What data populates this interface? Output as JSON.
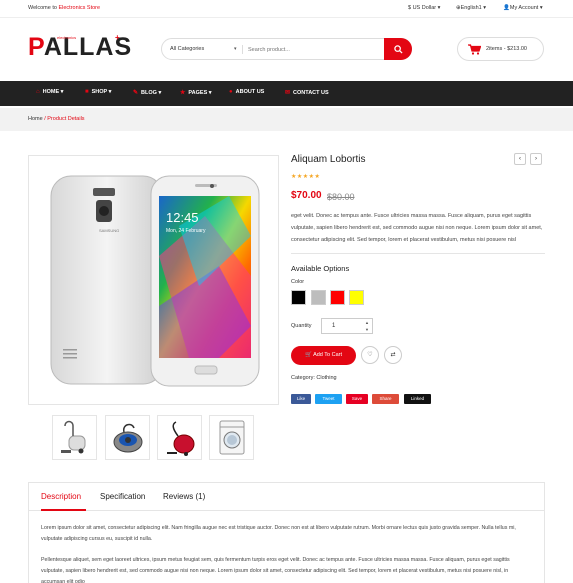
{
  "topbar": {
    "welcome_prefix": "Welcome to ",
    "welcome_store": "Electronics Store",
    "currency": "$ US Dollar",
    "language": "English1",
    "account": "My Account"
  },
  "logo": {
    "text_p": "P",
    "text_rest": "ALLAS",
    "sub": "electronics"
  },
  "search": {
    "category": "All Categories",
    "placeholder": "Search product..."
  },
  "cart": {
    "summary": "2items - $213.00"
  },
  "nav": {
    "items": [
      "HOME",
      "SHOP",
      "BLOG",
      "PAGES",
      "ABOUT US",
      "CONTACT US"
    ]
  },
  "breadcrumb": {
    "home": "Home",
    "sep": "/",
    "current": "Product Details"
  },
  "product": {
    "title": "Aliquam Lobortis",
    "rating": 0,
    "stars": "★★★★★",
    "price": "$70.00",
    "old_price": "$80.00",
    "description": "eget velit. Donec ac tempus ante. Fusce ultricies massa massa. Fusce aliquam, purus eget sagittis vulputate, sapien libero hendrerit est, sed commodo augue nisi non neque. Lorem ipsum dolor sit amet, consectetur adipiscing elit. Sed tempor, lorem et placerat vestibulum, metus nisi posuere nisl",
    "options_title": "Available Options",
    "color_label": "Color",
    "colors": [
      "#000000",
      "#bdbdbd",
      "#ff0000",
      "#ffff00"
    ],
    "quantity_label": "Quantity",
    "quantity": "1",
    "add_to_cart": "Add To Cart",
    "category_label": "Category:",
    "category_value": "Clothing",
    "share": [
      "Like",
      "Tweet",
      "Save",
      "Share",
      "Linked"
    ],
    "share_colors": [
      "#3b5998",
      "#1da1f2",
      "#e60023",
      "#dd4b39",
      "#111111"
    ]
  },
  "tabs": {
    "items": [
      "Description",
      "Specification",
      "Reviews (1)"
    ],
    "para1": "Lorem ipsum dolor sit amet, consectetur adipiscing elit. Nam fringilla augue nec est tristique auctor. Donec non est at libero vulputate rutrum. Morbi ornare lectus quis justo gravida semper. Nulla tellus mi, vulputate adipiscing cursus eu, suscipit id nulla.",
    "para2": "Pellentesque aliquet, sem eget laoreet ultrices, ipsum metus feugiat sem, quis fermentum turpis eros eget velit. Donec ac tempus ante. Fusce ultricies massa massa. Fusce aliquam, purus eget sagittis vulputate, sapien libero hendrerit est, sed commodo augue nisi non neque. Lorem ipsum dolor sit amet, consectetur adipiscing elit. Sed tempor, lorem et placerat vestibulum, metus nisi posuere nisl, in accumsan elit odio"
  },
  "phone": {
    "time": "12:45",
    "date": "Mon, 24 February"
  }
}
